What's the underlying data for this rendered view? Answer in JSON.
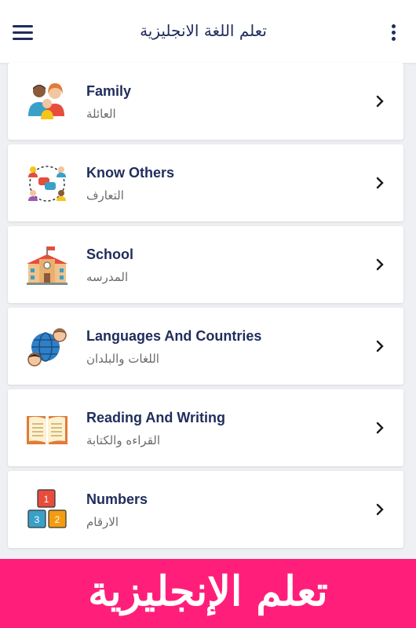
{
  "app_bar": {
    "title": "تعلم اللغة الانجليزية",
    "menu_icon": "hamburger-menu-icon",
    "more_icon": "more-vert-icon",
    "accent_color": "#1f2d5c"
  },
  "topics": [
    {
      "title": "Family",
      "subtitle": "العائلة",
      "icon": "family-icon"
    },
    {
      "title": "Know Others",
      "subtitle": "التعارف",
      "icon": "chat-people-icon"
    },
    {
      "title": "School",
      "subtitle": "المدرسه",
      "icon": "school-building-icon"
    },
    {
      "title": "Languages And Countries",
      "subtitle": "اللغات والبلدان",
      "icon": "globe-people-icon"
    },
    {
      "title": "Reading And Writing",
      "subtitle": "القراءه والكتابة",
      "icon": "open-book-icon"
    },
    {
      "title": "Numbers",
      "subtitle": "الارقام",
      "icon": "number-blocks-icon"
    }
  ],
  "banner": {
    "text": "تعلم الإنجليزية",
    "color": "#ff1f7a"
  }
}
